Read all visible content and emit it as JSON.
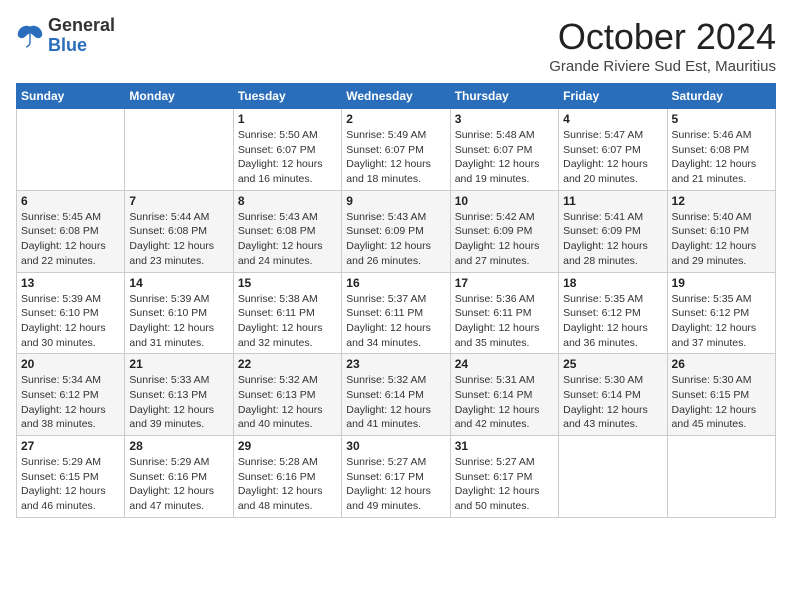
{
  "header": {
    "logo_general": "General",
    "logo_blue": "Blue",
    "month_title": "October 2024",
    "subtitle": "Grande Riviere Sud Est, Mauritius"
  },
  "calendar": {
    "days_of_week": [
      "Sunday",
      "Monday",
      "Tuesday",
      "Wednesday",
      "Thursday",
      "Friday",
      "Saturday"
    ],
    "weeks": [
      [
        {
          "day": "",
          "info": ""
        },
        {
          "day": "",
          "info": ""
        },
        {
          "day": "1",
          "info": "Sunrise: 5:50 AM\nSunset: 6:07 PM\nDaylight: 12 hours\nand 16 minutes."
        },
        {
          "day": "2",
          "info": "Sunrise: 5:49 AM\nSunset: 6:07 PM\nDaylight: 12 hours\nand 18 minutes."
        },
        {
          "day": "3",
          "info": "Sunrise: 5:48 AM\nSunset: 6:07 PM\nDaylight: 12 hours\nand 19 minutes."
        },
        {
          "day": "4",
          "info": "Sunrise: 5:47 AM\nSunset: 6:07 PM\nDaylight: 12 hours\nand 20 minutes."
        },
        {
          "day": "5",
          "info": "Sunrise: 5:46 AM\nSunset: 6:08 PM\nDaylight: 12 hours\nand 21 minutes."
        }
      ],
      [
        {
          "day": "6",
          "info": "Sunrise: 5:45 AM\nSunset: 6:08 PM\nDaylight: 12 hours\nand 22 minutes."
        },
        {
          "day": "7",
          "info": "Sunrise: 5:44 AM\nSunset: 6:08 PM\nDaylight: 12 hours\nand 23 minutes."
        },
        {
          "day": "8",
          "info": "Sunrise: 5:43 AM\nSunset: 6:08 PM\nDaylight: 12 hours\nand 24 minutes."
        },
        {
          "day": "9",
          "info": "Sunrise: 5:43 AM\nSunset: 6:09 PM\nDaylight: 12 hours\nand 26 minutes."
        },
        {
          "day": "10",
          "info": "Sunrise: 5:42 AM\nSunset: 6:09 PM\nDaylight: 12 hours\nand 27 minutes."
        },
        {
          "day": "11",
          "info": "Sunrise: 5:41 AM\nSunset: 6:09 PM\nDaylight: 12 hours\nand 28 minutes."
        },
        {
          "day": "12",
          "info": "Sunrise: 5:40 AM\nSunset: 6:10 PM\nDaylight: 12 hours\nand 29 minutes."
        }
      ],
      [
        {
          "day": "13",
          "info": "Sunrise: 5:39 AM\nSunset: 6:10 PM\nDaylight: 12 hours\nand 30 minutes."
        },
        {
          "day": "14",
          "info": "Sunrise: 5:39 AM\nSunset: 6:10 PM\nDaylight: 12 hours\nand 31 minutes."
        },
        {
          "day": "15",
          "info": "Sunrise: 5:38 AM\nSunset: 6:11 PM\nDaylight: 12 hours\nand 32 minutes."
        },
        {
          "day": "16",
          "info": "Sunrise: 5:37 AM\nSunset: 6:11 PM\nDaylight: 12 hours\nand 34 minutes."
        },
        {
          "day": "17",
          "info": "Sunrise: 5:36 AM\nSunset: 6:11 PM\nDaylight: 12 hours\nand 35 minutes."
        },
        {
          "day": "18",
          "info": "Sunrise: 5:35 AM\nSunset: 6:12 PM\nDaylight: 12 hours\nand 36 minutes."
        },
        {
          "day": "19",
          "info": "Sunrise: 5:35 AM\nSunset: 6:12 PM\nDaylight: 12 hours\nand 37 minutes."
        }
      ],
      [
        {
          "day": "20",
          "info": "Sunrise: 5:34 AM\nSunset: 6:12 PM\nDaylight: 12 hours\nand 38 minutes."
        },
        {
          "day": "21",
          "info": "Sunrise: 5:33 AM\nSunset: 6:13 PM\nDaylight: 12 hours\nand 39 minutes."
        },
        {
          "day": "22",
          "info": "Sunrise: 5:32 AM\nSunset: 6:13 PM\nDaylight: 12 hours\nand 40 minutes."
        },
        {
          "day": "23",
          "info": "Sunrise: 5:32 AM\nSunset: 6:14 PM\nDaylight: 12 hours\nand 41 minutes."
        },
        {
          "day": "24",
          "info": "Sunrise: 5:31 AM\nSunset: 6:14 PM\nDaylight: 12 hours\nand 42 minutes."
        },
        {
          "day": "25",
          "info": "Sunrise: 5:30 AM\nSunset: 6:14 PM\nDaylight: 12 hours\nand 43 minutes."
        },
        {
          "day": "26",
          "info": "Sunrise: 5:30 AM\nSunset: 6:15 PM\nDaylight: 12 hours\nand 45 minutes."
        }
      ],
      [
        {
          "day": "27",
          "info": "Sunrise: 5:29 AM\nSunset: 6:15 PM\nDaylight: 12 hours\nand 46 minutes."
        },
        {
          "day": "28",
          "info": "Sunrise: 5:29 AM\nSunset: 6:16 PM\nDaylight: 12 hours\nand 47 minutes."
        },
        {
          "day": "29",
          "info": "Sunrise: 5:28 AM\nSunset: 6:16 PM\nDaylight: 12 hours\nand 48 minutes."
        },
        {
          "day": "30",
          "info": "Sunrise: 5:27 AM\nSunset: 6:17 PM\nDaylight: 12 hours\nand 49 minutes."
        },
        {
          "day": "31",
          "info": "Sunrise: 5:27 AM\nSunset: 6:17 PM\nDaylight: 12 hours\nand 50 minutes."
        },
        {
          "day": "",
          "info": ""
        },
        {
          "day": "",
          "info": ""
        }
      ]
    ]
  }
}
